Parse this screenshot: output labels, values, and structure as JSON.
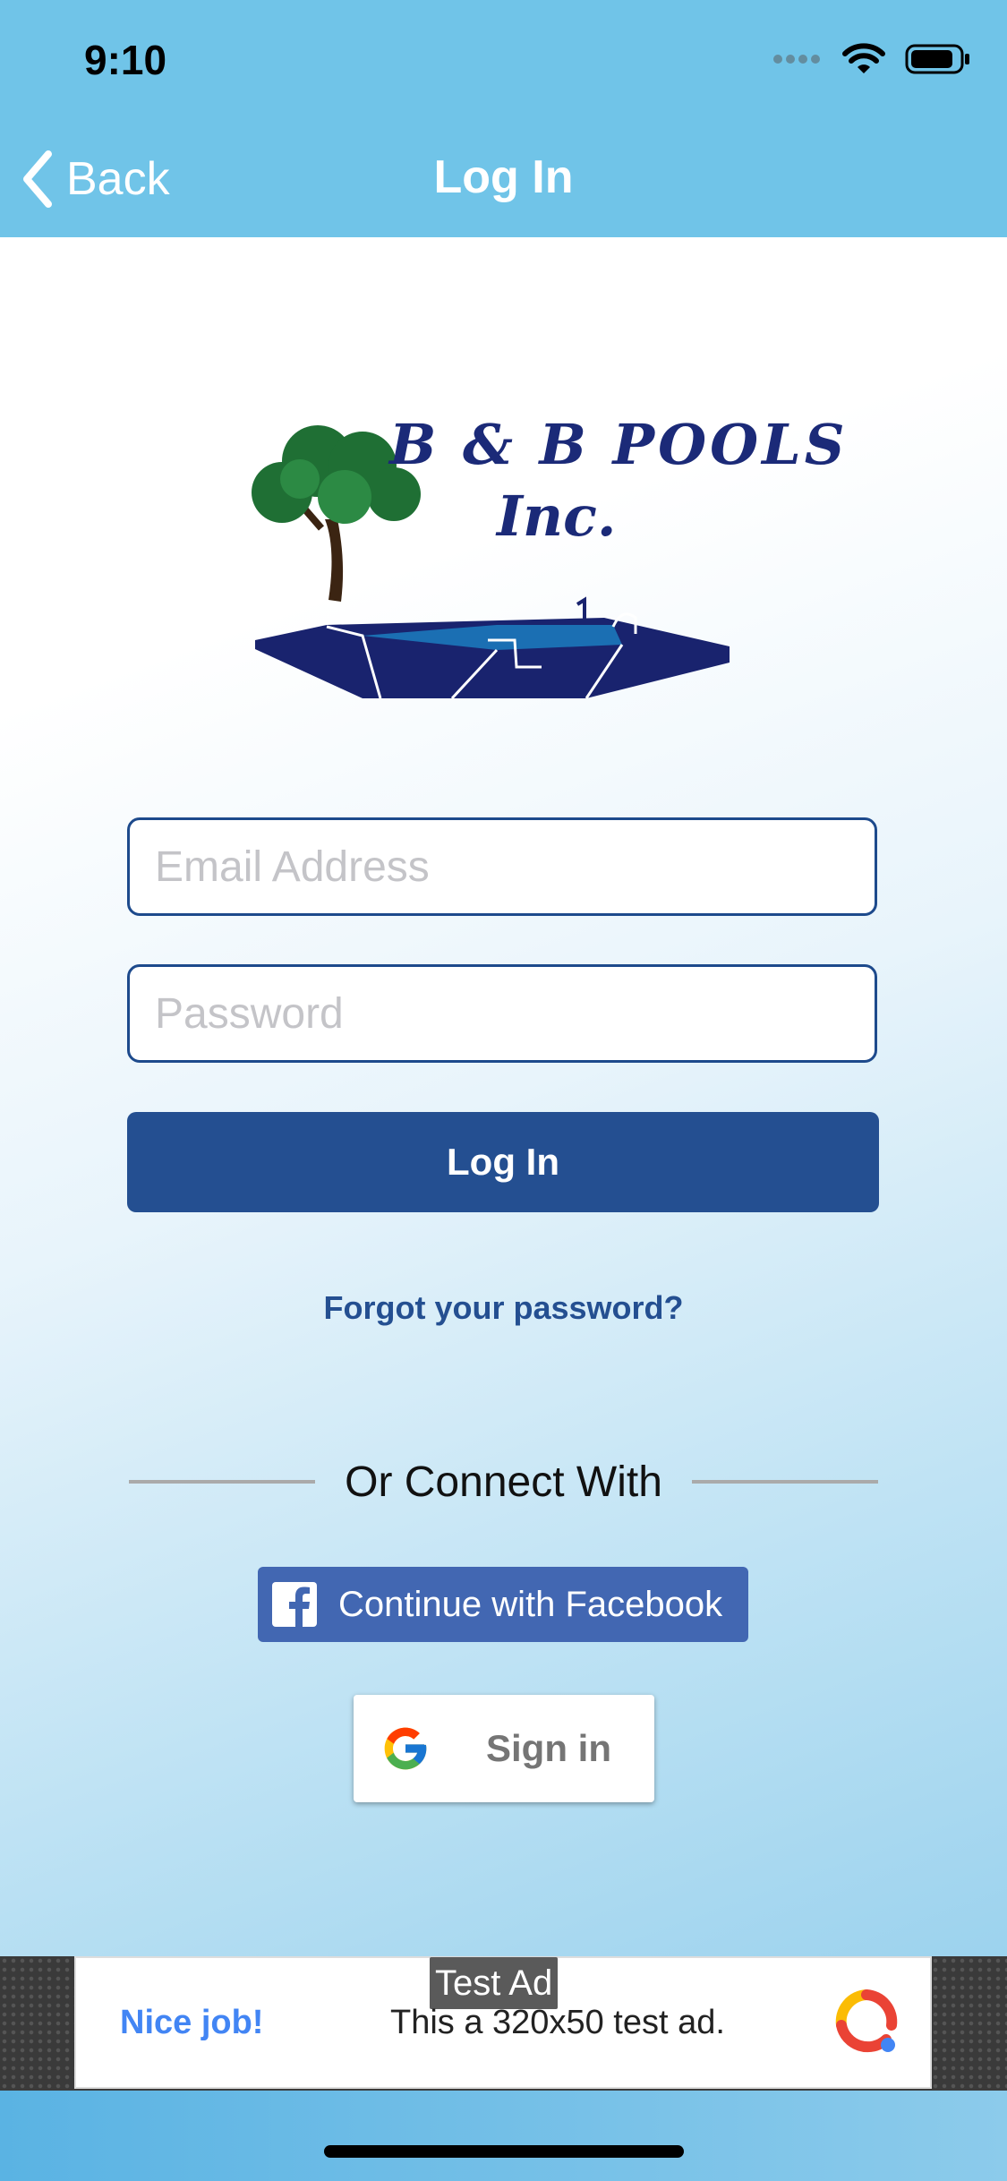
{
  "status_bar": {
    "time": "9:10"
  },
  "nav": {
    "back_label": "Back",
    "title": "Log In"
  },
  "logo": {
    "line1": "B & B POOLS",
    "line2": "Inc."
  },
  "form": {
    "email_placeholder": "Email Address",
    "password_placeholder": "Password",
    "login_label": "Log In",
    "forgot_label": "Forgot your password?"
  },
  "social": {
    "connect_label": "Or Connect With",
    "facebook_label": "Continue with Facebook",
    "google_label": "Sign in"
  },
  "ad": {
    "tag": "Test Ad",
    "headline": "Nice job!",
    "body": "This a 320x50 test ad."
  },
  "colors": {
    "nav_bar": "#70c4e8",
    "primary": "#244f91",
    "facebook": "#4267b2",
    "google_blue": "#4285f4"
  }
}
